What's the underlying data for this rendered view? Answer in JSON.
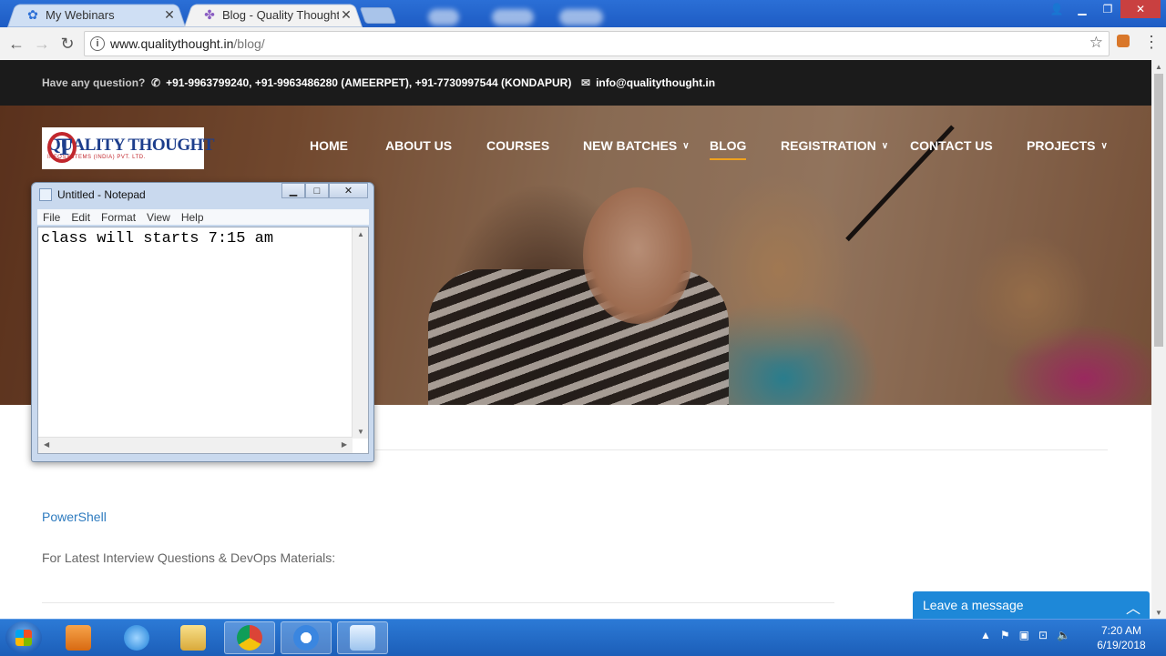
{
  "browser": {
    "tabs": [
      {
        "title": "My Webinars",
        "icon": "gear-flower-icon",
        "active": false
      },
      {
        "title": "Blog - Quality Thought",
        "icon": "site-favicon-icon",
        "active": true
      }
    ],
    "url_host": "www.qualitythought.in",
    "url_path": "/blog/"
  },
  "topbar": {
    "question": "Have any question?",
    "phones": "+91-9963799240, +91-9963486280 (AMEERPET), +91-7730997544 (KONDAPUR)",
    "email": "info@qualitythought.in"
  },
  "logo": {
    "brand": "QUALITY THOUGHT",
    "sub": "INFOSYSTEMS (INDIA) PVT. LTD."
  },
  "nav": {
    "items": [
      {
        "label": "HOME"
      },
      {
        "label": "ABOUT US"
      },
      {
        "label": "COURSES"
      },
      {
        "label": "NEW BATCHES",
        "dropdown": true
      },
      {
        "label": "BLOG",
        "active": true
      },
      {
        "label": "REGISTRATION",
        "dropdown": true
      },
      {
        "label": "CONTACT US"
      },
      {
        "label": "PROJECTS",
        "dropdown": true
      }
    ]
  },
  "content": {
    "link": "PowerShell",
    "text": "For Latest Interview Questions & DevOps Materials:"
  },
  "livechat": {
    "label": "Leave a message"
  },
  "notepad": {
    "title": "Untitled - Notepad",
    "menu": [
      "File",
      "Edit",
      "Format",
      "View",
      "Help"
    ],
    "text": "class will starts 7:15 am"
  },
  "taskbar": {
    "time": "7:20 AM",
    "date": "6/19/2018"
  },
  "colors": {
    "accent_nav": "#f0a21e",
    "link": "#2e7bbf",
    "livechat": "#1e88d8",
    "topbar_bg": "#1b1b1b"
  }
}
